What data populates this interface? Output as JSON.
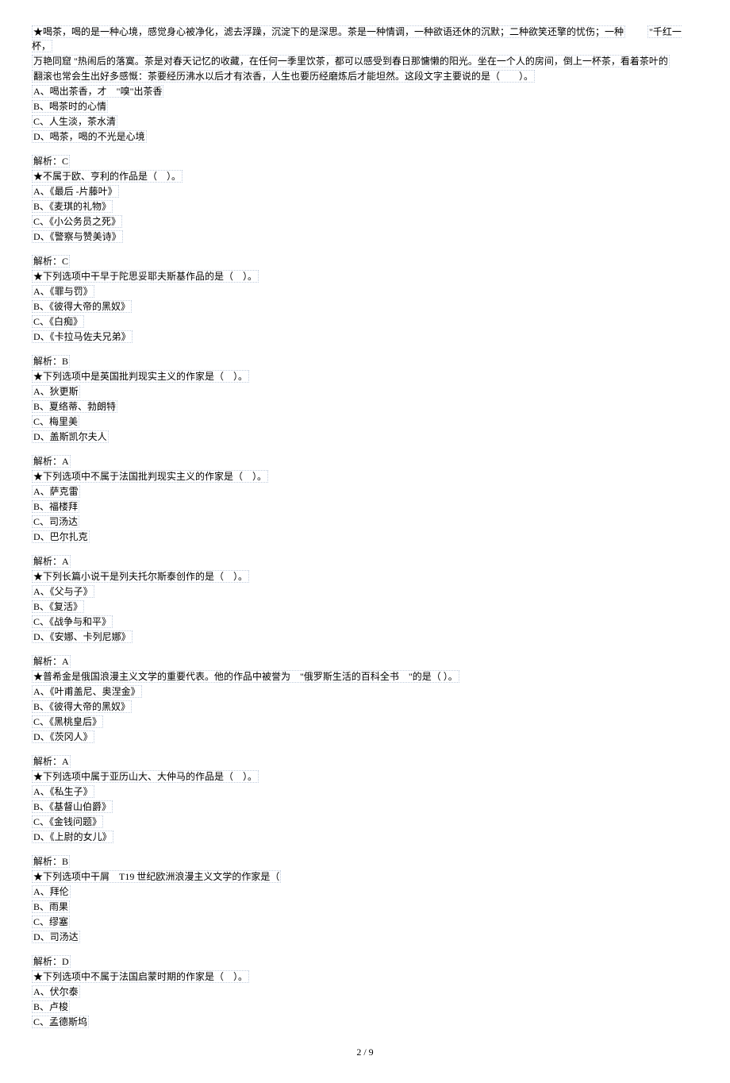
{
  "q1": {
    "stem1": "★喝茶，喝的是一种心境，感觉身心被净化，滤去浮躁，沉淀下的是深思。茶是一种情调，一种欲语还休的沉默；二种欲笑还擎的忧伤；一种",
    "stem1_quote": "\"千红一杯，",
    "stem2": "万艳同窟 \"热闹后的落寞。茶是对春天记忆的收藏，在任何一季里饮茶，都可以感受到春日那慵懒的阳光。坐在一个人的房间，倒上一杯茶，看着茶叶的",
    "stem3": "翻滚也常会生出好多感慨：茶要经历沸水以后才有浓香，人生也要历经磨炼后才能坦然。这段文字主要说的是（　　）。",
    "optA": "A、喝出茶香，才　\"嗅\"出茶香",
    "optB": "B、喝茶时的心情",
    "optC": "C、人生淡，茶水清",
    "optD": "D、喝茶，喝的不光是心境",
    "answer": "解析：C"
  },
  "q2": {
    "stem": "★不属于欧、亨利的作品是（　）。",
    "optA": "A、《最后 -片藤叶》",
    "optB": "B、《麦琪的礼物》",
    "optC": "C、《小公务员之死》",
    "optD": "D、《警察与赞美诗》",
    "answer": "解析：C"
  },
  "q3": {
    "stem": "★下列选项中干早于陀思妥耶夫斯基作品的是（　）。",
    "optA": "A、《罪与罚》",
    "optB": "B、《彼得大帝的黑奴》",
    "optC": "C、《白痴》",
    "optD": "D、《卡拉马佐夫兄弟》",
    "answer": "解析：B"
  },
  "q4": {
    "stem": "★下列选项中是英国批判现实主义的作家是（　）。",
    "optA": "A、狄更斯",
    "optB": "B、夏络蒂、勃朗特",
    "optC": "C、梅里美",
    "optD": "D、盖斯凯尔夫人",
    "answer": "解析：A"
  },
  "q5": {
    "stem": "★下列选项中不属于法国批判现实主义的作家是（　）。",
    "optA": "A、萨克雷",
    "optB": "B、福楼拜",
    "optC": "C、司汤达",
    "optD": "D、巴尔扎克",
    "answer": "解析：A"
  },
  "q6": {
    "stem": "★下列长篇小说干是列夫托尔斯泰创作的是（　）。",
    "optA": "A、《父与子》",
    "optB": "B、《复活》",
    "optC": "C、《战争与和平》",
    "optD": "D、《安娜、卡列尼娜》",
    "answer": "解析：A"
  },
  "q7": {
    "stem_a": "★普希金是俄国浪漫主义文学的重要代表。他的作品中被誉为　\"俄罗斯生活的百科全书　\"的是（ ）。",
    "optA": "A、《叶甫盖尼、奥涅金》",
    "optB": "B、《彼得大帝的黑奴》",
    "optC": "C、《黑桃皇后》",
    "optD": "D、《茨冈人》",
    "answer": "解析：A"
  },
  "q8": {
    "stem": "★下列选项中属于亚历山大、大仲马的作品是（　）。",
    "optA": "A、《私生子》",
    "optB": "B、《基督山伯爵》",
    "optC": "C、《金钱问题》",
    "optD": "D、《上尉的女儿》",
    "answer": "解析：B"
  },
  "q9": {
    "stem": "★下列选项中干屑　T19 世纪欧洲浪漫主义文学的作家是（",
    "optA": "A、拜伦",
    "optB": "B、雨果",
    "optC": "C、缪塞",
    "optD": "D、司汤达",
    "answer": "解析：D"
  },
  "q10": {
    "stem": "★下列选项中不属于法国启蒙时期的作家是（　）。",
    "optA": "A、伏尔泰",
    "optB": "B、卢梭",
    "optC": "C、孟德斯坞"
  },
  "page": "2 / 9"
}
